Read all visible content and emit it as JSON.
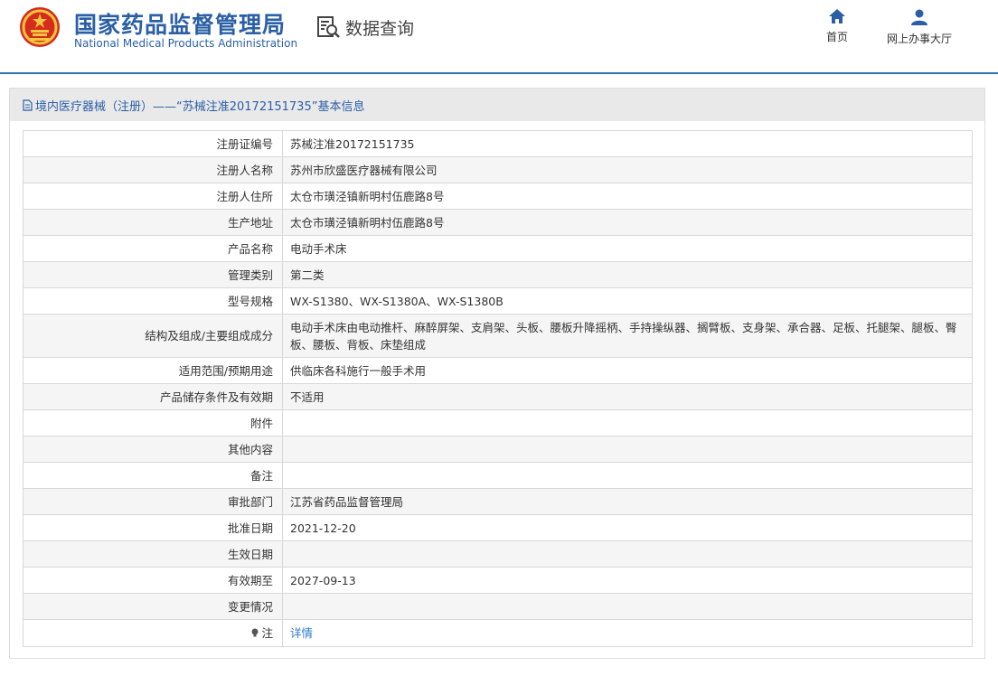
{
  "header": {
    "org_name_cn": "国家药品监督管理局",
    "org_name_en": "National Medical Products Administration",
    "query_label": "数据查询",
    "nav": [
      {
        "label": "首页",
        "icon": "home-icon"
      },
      {
        "label": "网上办事大厅",
        "icon": "user-icon"
      }
    ],
    "accent_color": "#2a5fa6"
  },
  "panel": {
    "title": "境内医疗器械（注册）——“苏械注准20172151735”基本信息"
  },
  "rows": [
    {
      "label": "注册证编号",
      "value": "苏械注准20172151735"
    },
    {
      "label": "注册人名称",
      "value": "苏州市欣盛医疗器械有限公司"
    },
    {
      "label": "注册人住所",
      "value": "太仓市璜泾镇新明村伍鹿路8号"
    },
    {
      "label": "生产地址",
      "value": "太仓市璜泾镇新明村伍鹿路8号"
    },
    {
      "label": "产品名称",
      "value": "电动手术床"
    },
    {
      "label": "管理类别",
      "value": "第二类"
    },
    {
      "label": "型号规格",
      "value": "WX-S1380、WX-S1380A、WX-S1380B"
    },
    {
      "label": "结构及组成/主要组成成分",
      "value": "电动手术床由电动推杆、麻醉屏架、支肩架、头板、腰板升降摇柄、手持操纵器、搁臂板、支身架、承合器、足板、托腿架、腿板、臀板、腰板、背板、床垫组成"
    },
    {
      "label": "适用范围/预期用途",
      "value": "供临床各科施行一般手术用"
    },
    {
      "label": "产品储存条件及有效期",
      "value": "不适用"
    },
    {
      "label": "附件",
      "value": ""
    },
    {
      "label": "其他内容",
      "value": ""
    },
    {
      "label": "备注",
      "value": ""
    },
    {
      "label": "审批部门",
      "value": "江苏省药品监督管理局"
    },
    {
      "label": "批准日期",
      "value": "2021-12-20"
    },
    {
      "label": "生效日期",
      "value": ""
    },
    {
      "label": "有效期至",
      "value": "2027-09-13"
    },
    {
      "label": "变更情况",
      "value": ""
    },
    {
      "label": "注",
      "value": "详情"
    }
  ]
}
